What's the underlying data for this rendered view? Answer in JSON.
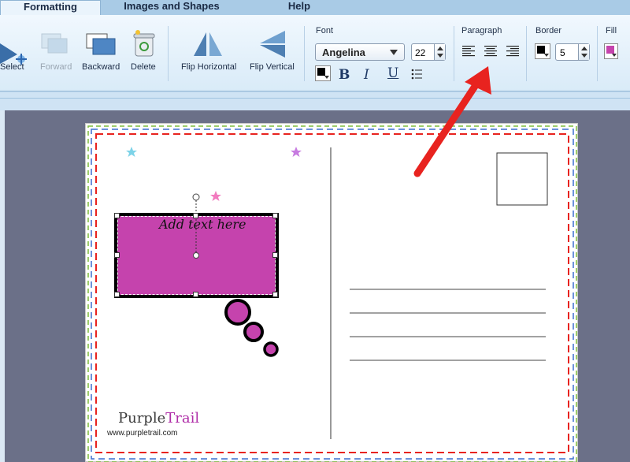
{
  "tabs": [
    {
      "label": "Formatting",
      "active": true
    },
    {
      "label": "Images and Shapes",
      "active": false
    },
    {
      "label": "Help",
      "active": false
    }
  ],
  "toolbar": {
    "select_label": "Select",
    "forward_label": "Forward",
    "backward_label": "Backward",
    "delete_label": "Delete",
    "flip_horizontal_label": "Flip Horizontal",
    "flip_vertical_label": "Flip Vertical"
  },
  "font_group": {
    "title": "Font",
    "font_name": "Angelina",
    "font_size": "22"
  },
  "paragraph_group": {
    "title": "Paragraph"
  },
  "border_group": {
    "title": "Border",
    "width": "5"
  },
  "fill_group": {
    "title": "Fill"
  },
  "canvas": {
    "bubble_text": "Add text here",
    "brand_purple": "Purple",
    "brand_trail": "Trail",
    "url": "www.purpletrail.com"
  },
  "colors": {
    "bubble_fill": "#c543ad",
    "arrow_red": "#e8231f",
    "accent_blue": "#3b6fd0"
  },
  "icons": [
    "select-arrow-icon",
    "forward-icon",
    "backward-icon",
    "trash-icon",
    "flip-horizontal-icon",
    "flip-vertical-icon",
    "text-color-icon",
    "bold-icon",
    "italic-icon",
    "underline-icon",
    "list-icon",
    "align-left-icon",
    "align-center-icon",
    "align-right-icon",
    "border-color-icon",
    "fill-color-icon",
    "star-icon"
  ]
}
